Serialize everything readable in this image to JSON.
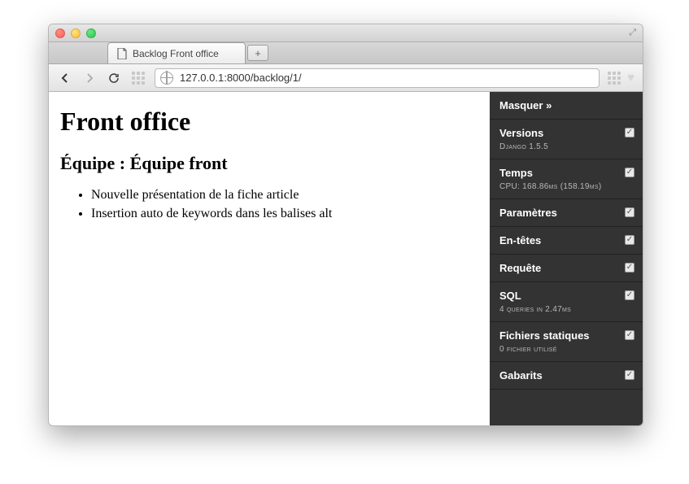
{
  "window": {
    "tab_title": "Backlog Front office"
  },
  "url": "127.0.0.1:8000/backlog/1/",
  "page": {
    "h1": "Front office",
    "h2": "Équipe : Équipe front",
    "items": [
      "Nouvelle présentation de la fiche article",
      "Insertion auto de keywords dans les balises alt"
    ]
  },
  "debug": {
    "hide": "Masquer »",
    "panels": [
      {
        "title": "Versions",
        "sub": "Django 1.5.5"
      },
      {
        "title": "Temps",
        "sub": "CPU: 168.86ms (158.19ms)"
      },
      {
        "title": "Paramètres",
        "sub": ""
      },
      {
        "title": "En-têtes",
        "sub": ""
      },
      {
        "title": "Requête",
        "sub": ""
      },
      {
        "title": "SQL",
        "sub": "4 queries in 2.47ms"
      },
      {
        "title": "Fichiers statiques",
        "sub": "0 fichier utilisé"
      },
      {
        "title": "Gabarits",
        "sub": ""
      }
    ]
  }
}
